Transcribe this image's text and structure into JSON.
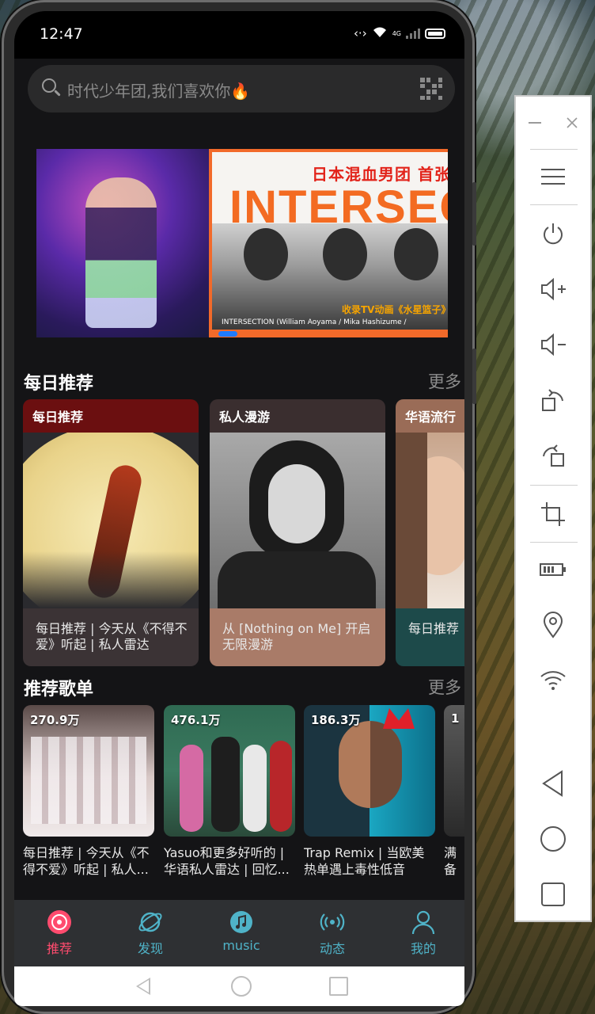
{
  "status_bar": {
    "time": "12:47",
    "network": "4G"
  },
  "search": {
    "placeholder": "时代少年团,我们喜欢你🔥"
  },
  "banner": {
    "right_subtitle": "日本混血男团 首张",
    "right_title": "INTERSEC",
    "right_caption": "收录TV动画《水星篮子》",
    "right_credits": "INTERSECTION (William Aoyama / Mika Hashizume /"
  },
  "daily": {
    "title": "每日推荐",
    "more": "更多",
    "cards": [
      {
        "header": "每日推荐",
        "footer": "每日推荐 | 今天从《不得不爱》听起 | 私人雷达",
        "head_color": "#6b0f10",
        "foot_color": "#3b3335"
      },
      {
        "header": "私人漫游",
        "footer": "从 [Nothing on Me] 开启无限漫游",
        "head_color": "#3a2e2f",
        "foot_color": "#a97b68"
      },
      {
        "header": "华语流行",
        "footer": "每日推荐 | 今天从《不得不爱》听起",
        "head_color": "#9a6c57",
        "foot_color": "#1d4a4a"
      }
    ]
  },
  "playlists": {
    "title": "推荐歌单",
    "more": "更多",
    "items": [
      {
        "count": "270.9万",
        "title": "每日推荐 | 今天从《不得不爱》听起 | 私人..."
      },
      {
        "count": "476.1万",
        "title": "Yasuo和更多好听的 | 华语私人雷达 | 回忆..."
      },
      {
        "count": "186.3万",
        "title": "Trap Remix | 当欧美热单遇上毒性低音"
      },
      {
        "count": "1",
        "title": "满 备"
      }
    ]
  },
  "tabs": [
    {
      "label": "推荐",
      "icon": "disc-icon",
      "active": true
    },
    {
      "label": "发现",
      "icon": "planet-icon",
      "active": false
    },
    {
      "label": "music",
      "icon": "music-note-icon",
      "active": false
    },
    {
      "label": "动态",
      "icon": "broadcast-icon",
      "active": false
    },
    {
      "label": "我的",
      "icon": "user-icon",
      "active": false
    }
  ],
  "colors": {
    "accent": "#ff4b6e",
    "tab_inactive": "#4fb3c8",
    "background": "#141416"
  },
  "emulator_toolbar": [
    "minimize-icon",
    "close-icon",
    "menu-icon",
    "power-icon",
    "volume-up-icon",
    "volume-down-icon",
    "rotate-right-icon",
    "rotate-left-icon",
    "crop-icon",
    "battery-icon",
    "location-icon",
    "wifi-icon",
    "back-icon",
    "home-icon",
    "overview-icon"
  ]
}
